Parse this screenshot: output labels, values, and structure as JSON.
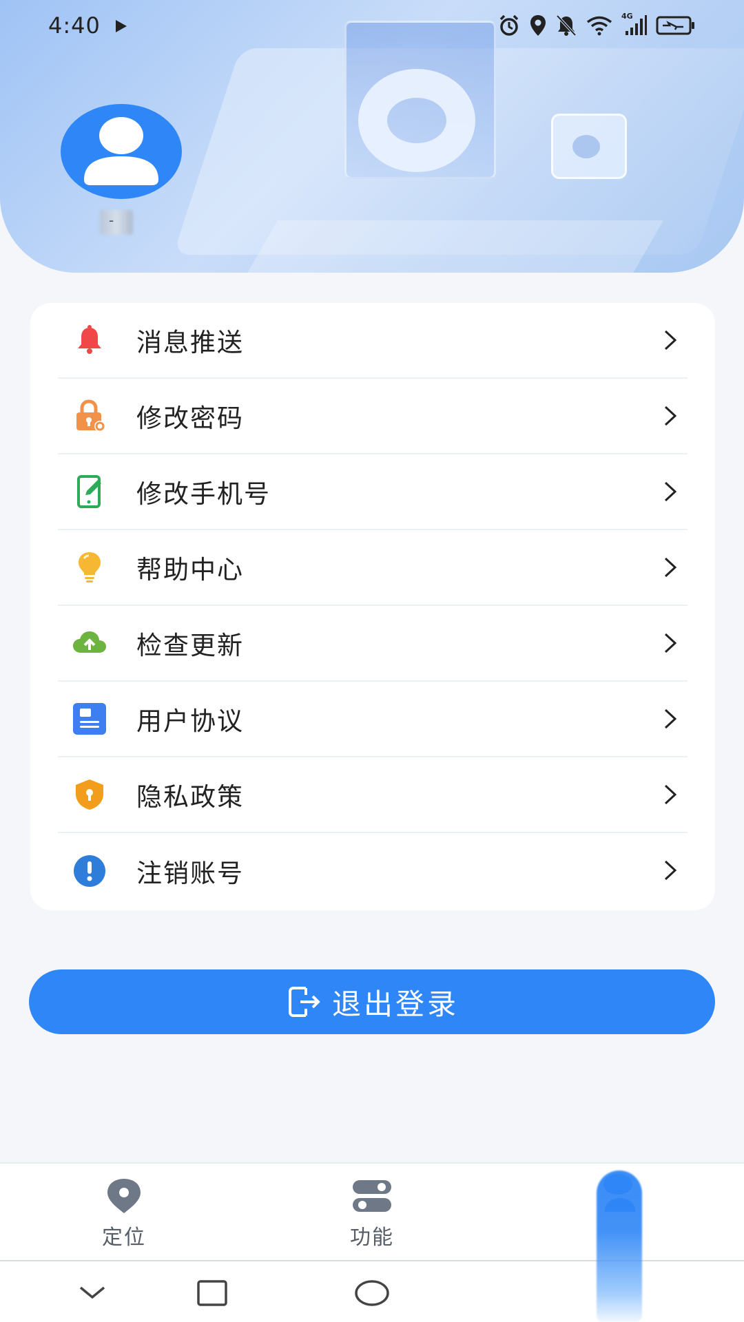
{
  "status_bar": {
    "time": "4:40",
    "network_label": "4G"
  },
  "profile": {
    "username": "-"
  },
  "menu": {
    "items": [
      {
        "label": "消息推送",
        "icon": "bell-icon",
        "color": "#f04848"
      },
      {
        "label": "修改密码",
        "icon": "lock-settings-icon",
        "color": "#f2914a"
      },
      {
        "label": "修改手机号",
        "icon": "phone-edit-icon",
        "color": "#2cab58"
      },
      {
        "label": "帮助中心",
        "icon": "lightbulb-icon",
        "color": "#f6b733"
      },
      {
        "label": "检查更新",
        "icon": "cloud-upload-icon",
        "color": "#6cb33f"
      },
      {
        "label": "用户协议",
        "icon": "document-icon",
        "color": "#3d7ef0"
      },
      {
        "label": "隐私政策",
        "icon": "shield-keyhole-icon",
        "color": "#f29e1c"
      },
      {
        "label": "注销账号",
        "icon": "exclamation-circle-icon",
        "color": "#2f7ddb"
      }
    ]
  },
  "logout": {
    "label": "退出登录"
  },
  "bottom_nav": {
    "tabs": [
      {
        "label": "定位",
        "icon": "location-pin-icon"
      },
      {
        "label": "功能",
        "icon": "toggles-icon"
      },
      {
        "label": "",
        "icon": "person-icon"
      }
    ]
  },
  "colors": {
    "accent": "#2f86f6",
    "background": "#f4f6f9"
  }
}
